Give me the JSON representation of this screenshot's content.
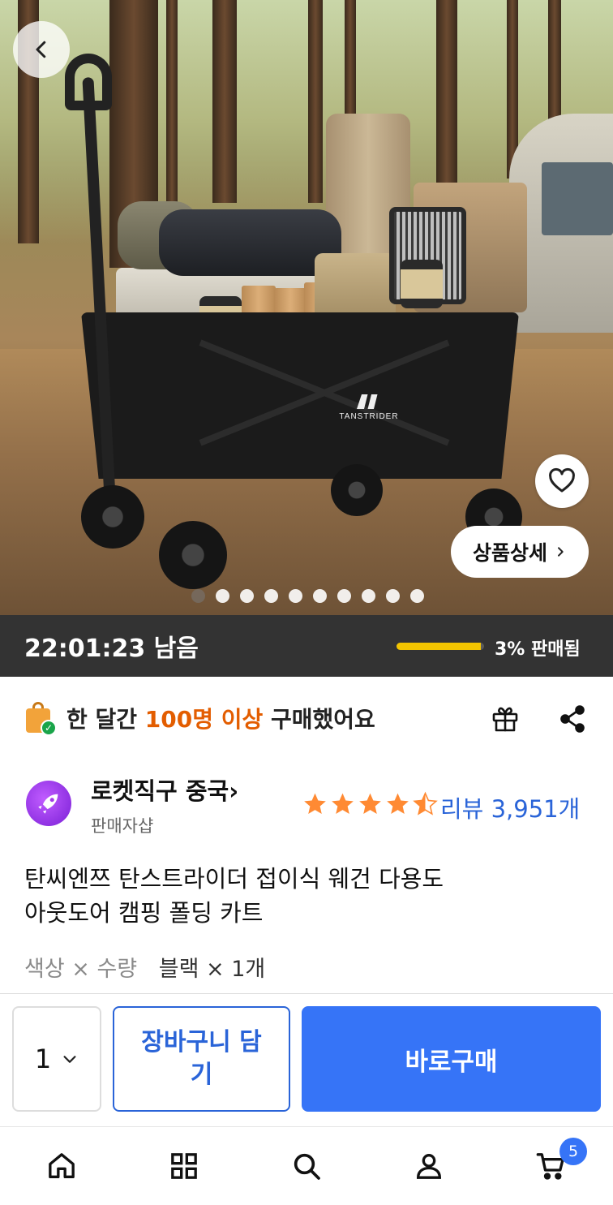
{
  "hero": {
    "brand_text": "TANSTRIDER",
    "detail_button_label": "상품상세",
    "image_count": 10,
    "active_index": 0
  },
  "timer": {
    "remaining": "22:01:23 남음",
    "sold_percent": 3,
    "sold_label": "3% 판매됨",
    "progress_color": "#f2c400"
  },
  "purchase_banner": {
    "prefix": "한 달간 ",
    "highlight": "100명 이상",
    "suffix": " 구매했어요",
    "highlight_color": "#e35d00"
  },
  "seller": {
    "name": "로켓직구 중국",
    "name_chevron": "›",
    "subtitle": "판매자샵"
  },
  "rating": {
    "stars": 4.5,
    "review_label": "리뷰 3,951개",
    "star_color": "#ff8a33",
    "link_color": "#2a64d8"
  },
  "product": {
    "title_line1": "탄씨엔쯔 탄스트라이더 접이식 웨건 다용도",
    "title_line2": "아웃도어 캠핑 폴딩 카트"
  },
  "option": {
    "label": "색상 × 수량",
    "value": "블랙 × 1개"
  },
  "actions": {
    "quantity": "1",
    "cart_button_label": "장바구니 담기",
    "buy_button_label": "바로구매",
    "primary_color": "#3674f7"
  },
  "bottom_nav": {
    "items": [
      "home-icon",
      "categories-icon",
      "search-icon",
      "my-page-icon",
      "cart-icon"
    ],
    "cart_badge": "5"
  }
}
